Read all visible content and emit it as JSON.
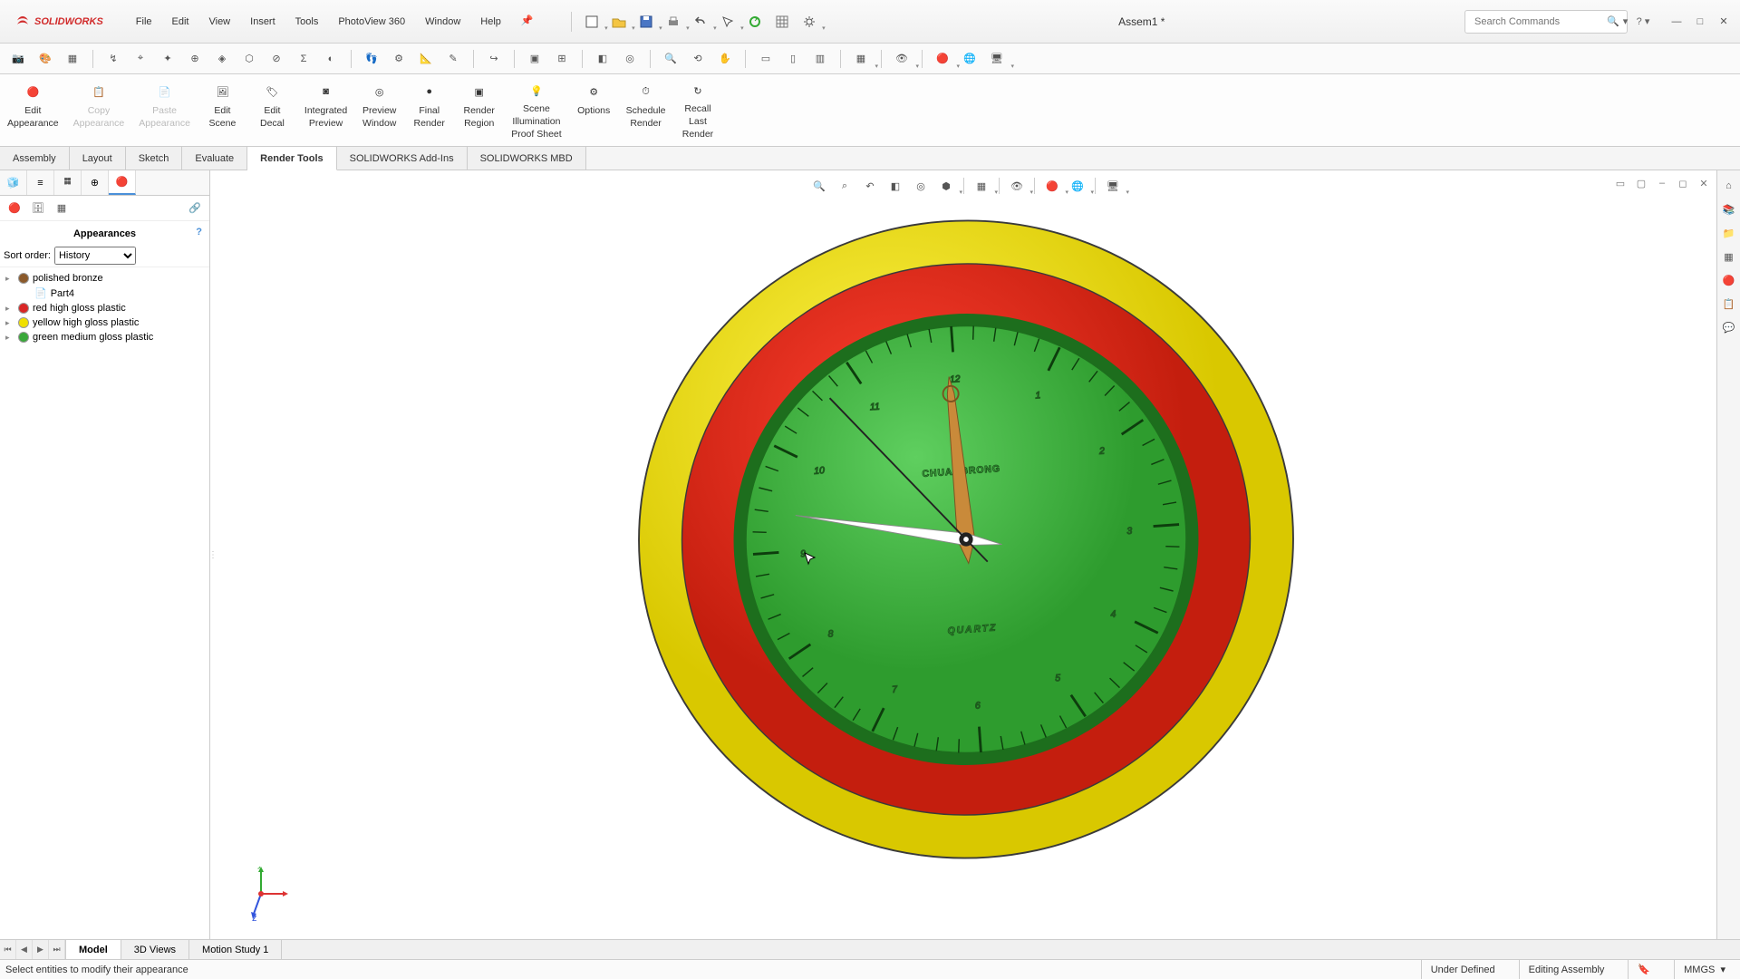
{
  "app": {
    "name": "SOLIDWORKS",
    "doc_title": "Assem1 *"
  },
  "menu": [
    "File",
    "Edit",
    "View",
    "Insert",
    "Tools",
    "PhotoView 360",
    "Window",
    "Help"
  ],
  "search": {
    "placeholder": "Search Commands"
  },
  "ribbon": [
    {
      "id": "edit-appearance",
      "l1": "Edit",
      "l2": "Appearance",
      "dis": false
    },
    {
      "id": "copy-appearance",
      "l1": "Copy",
      "l2": "Appearance",
      "dis": true
    },
    {
      "id": "paste-appearance",
      "l1": "Paste",
      "l2": "Appearance",
      "dis": true
    },
    {
      "id": "edit-scene",
      "l1": "Edit",
      "l2": "Scene",
      "dis": false
    },
    {
      "id": "edit-decal",
      "l1": "Edit",
      "l2": "Decal",
      "dis": false
    },
    {
      "id": "integrated-preview",
      "l1": "Integrated",
      "l2": "Preview",
      "dis": false
    },
    {
      "id": "preview-window",
      "l1": "Preview",
      "l2": "Window",
      "dis": false
    },
    {
      "id": "final-render",
      "l1": "Final",
      "l2": "Render",
      "dis": false
    },
    {
      "id": "render-region",
      "l1": "Render",
      "l2": "Region",
      "dis": false
    },
    {
      "id": "scene-illum",
      "l1": "Scene",
      "l2": "Illumination",
      "l3": "Proof Sheet",
      "dis": false
    },
    {
      "id": "options",
      "l1": "Options",
      "l2": "",
      "dis": false
    },
    {
      "id": "schedule-render",
      "l1": "Schedule",
      "l2": "Render",
      "dis": false
    },
    {
      "id": "recall-last",
      "l1": "Recall",
      "l2": "Last",
      "l3": "Render",
      "dis": false
    }
  ],
  "tabs": [
    "Assembly",
    "Layout",
    "Sketch",
    "Evaluate",
    "Render Tools",
    "SOLIDWORKS Add-Ins",
    "SOLIDWORKS MBD"
  ],
  "active_tab": "Render Tools",
  "panel": {
    "title": "Appearances",
    "sort_label": "Sort order:",
    "sort_value": "History",
    "items": [
      {
        "tw": "▸",
        "color": "#8b5a2b",
        "label": "polished bronze",
        "child": null
      },
      {
        "tw": "",
        "color": null,
        "label": "Part4",
        "child": true
      },
      {
        "tw": "▸",
        "color": "#d92626",
        "label": "red high gloss plastic",
        "child": null
      },
      {
        "tw": "▸",
        "color": "#f0e000",
        "label": "yellow high gloss plastic",
        "child": null
      },
      {
        "tw": "▸",
        "color": "#3aa83a",
        "label": "green medium gloss plastic",
        "child": null
      }
    ]
  },
  "bottom_tabs": [
    "Model",
    "3D Views",
    "Motion Study 1"
  ],
  "active_bottom": "Model",
  "status": {
    "prompt": "Select entities to modify their appearance",
    "def": "Under Defined",
    "mode": "Editing Assembly",
    "units": "MMGS"
  },
  "clock": {
    "brand": "CHUANGRONG",
    "sub": "QUARTZ"
  },
  "triad": {
    "x": "x",
    "y": "y",
    "z": "z"
  }
}
